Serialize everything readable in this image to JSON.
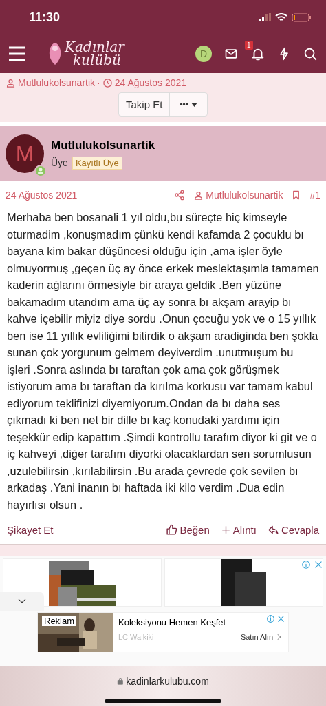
{
  "status_bar": {
    "time": "11:30"
  },
  "nav": {
    "logo_top": "Kadınlar",
    "logo_bottom": "kulübü",
    "user_initial": "D",
    "notification_count": "1"
  },
  "thread_meta": {
    "author": "Mutlulukolsunartik",
    "separator": "·",
    "date": "24 Ağustos 2021"
  },
  "thread_actions": {
    "follow": "Takip Et",
    "more": "•••"
  },
  "user_card": {
    "avatar_letter": "M",
    "name": "Mutlulukolsunartik",
    "role": "Üye",
    "badge": "Kayıtlı Üye"
  },
  "post": {
    "date": "24 Ağustos 2021",
    "author": "Mutlulukolsunartik",
    "number": "#1",
    "body": "Merhaba ben bosanali 1 yıl oldu,bu süreçte hiç kimseyle oturmadim ,konuşmadım çünkü kendi kafamda 2 çocuklu bı bayana kim bakar düşüncesi olduğu için ,ama işler öyle olmuyormuş ,geçen üç ay önce erkek meslektaşımla tamamen kaderin ağlarını örmesiyle bir araya geldik .Ben yüzüne bakamadım utandım ama üç ay sonra bı akşam arayip bı kahve içebilir miyiz diye sordu .Onun çocuğu yok ve o 15 yıllık ben ise 11 yıllık evliliğimi bitirdik o akşam aradiginda ben şokla sunan çok yorgunum gelmem deyiverdim .unutmuşum bu işleri .Sonra aslında bı taraftan çok ama çok görüşmek istiyorum ama bı taraftan da kırılma korkusu var tamam kabul ediyorum teklifinizi diyemiyorum.Ondan da bı daha ses çıkmadı ki ben net bir dille bı kaç konudaki yardımı için teşekkür edip kapattım .Şimdi kontrollu tarafım diyor ki git ve o iç kahveyi ,diğer tarafım diyorki olacaklardan sen sorumlusun ,uzulebilirsin ,kırılabilirsin .Bu arada çevrede çok sevilen bı arkadaş .Yani inanın bı haftada iki kilo verdim .Dua edin hayırlısı olsun .",
    "report": "Şikayet Et",
    "like": "Beğen",
    "quote": "Alıntı",
    "reply": "Cevapla"
  },
  "ad": {
    "label": "Reklam",
    "headline": "Koleksiyonu Hemen Keşfet",
    "advertiser": "LC Waikiki",
    "cta": "Satın Alın"
  },
  "browser": {
    "url": "kadinlarkulubu.com"
  }
}
